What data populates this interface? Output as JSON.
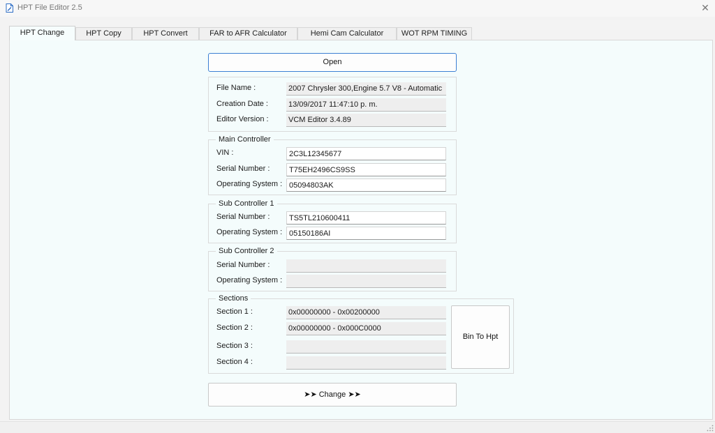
{
  "window": {
    "title": "HPT File Editor 2.5"
  },
  "tabs": [
    {
      "label": "HPT Change"
    },
    {
      "label": "HPT Copy"
    },
    {
      "label": "HPT Convert"
    },
    {
      "label": "FAR to AFR Calculator"
    },
    {
      "label": "Hemi Cam Calculator"
    },
    {
      "label": "WOT RPM TIMING"
    }
  ],
  "buttons": {
    "open": "Open",
    "bin_to_hpt": "Bin To Hpt",
    "change": "➤➤  Change  ➤➤"
  },
  "file_info": {
    "file_name_label": "File Name :",
    "file_name": "2007 Chrysler 300,Engine 5.7 V8 - Automatic",
    "creation_date_label": "Creation Date :",
    "creation_date": "13/09/2017 11:47:10 p. m.",
    "editor_version_label": "Editor Version :",
    "editor_version": "VCM Editor 3.4.89"
  },
  "main_controller": {
    "title": "Main Controller",
    "vin_label": "VIN :",
    "vin": "2C3L12345677",
    "serial_label": "Serial Number :",
    "serial": "T75EH2496CS9SS",
    "os_label": "Operating System :",
    "os": "05094803AK"
  },
  "sub_controller_1": {
    "title": "Sub Controller 1",
    "serial_label": "Serial Number :",
    "serial": "TS5TL210600411",
    "os_label": "Operating System :",
    "os": "05150186AI"
  },
  "sub_controller_2": {
    "title": "Sub Controller 2",
    "serial_label": "Serial Number :",
    "serial": "",
    "os_label": "Operating System :",
    "os": ""
  },
  "sections": {
    "title": "Sections",
    "s1_label": "Section 1 :",
    "s1": "0x00000000 - 0x00200000",
    "s2_label": "Section 2 :",
    "s2": "0x00000000 - 0x000C0000",
    "s3_label": "Section 3 :",
    "s3": "",
    "s4_label": "Section 4 :",
    "s4": ""
  },
  "icons": {
    "app": "document-edit-icon",
    "close": "close-icon",
    "grip": "resize-grip-icon"
  },
  "colors": {
    "accent_border": "#3b7fd3",
    "panel_bg": "#f4fcfc"
  }
}
